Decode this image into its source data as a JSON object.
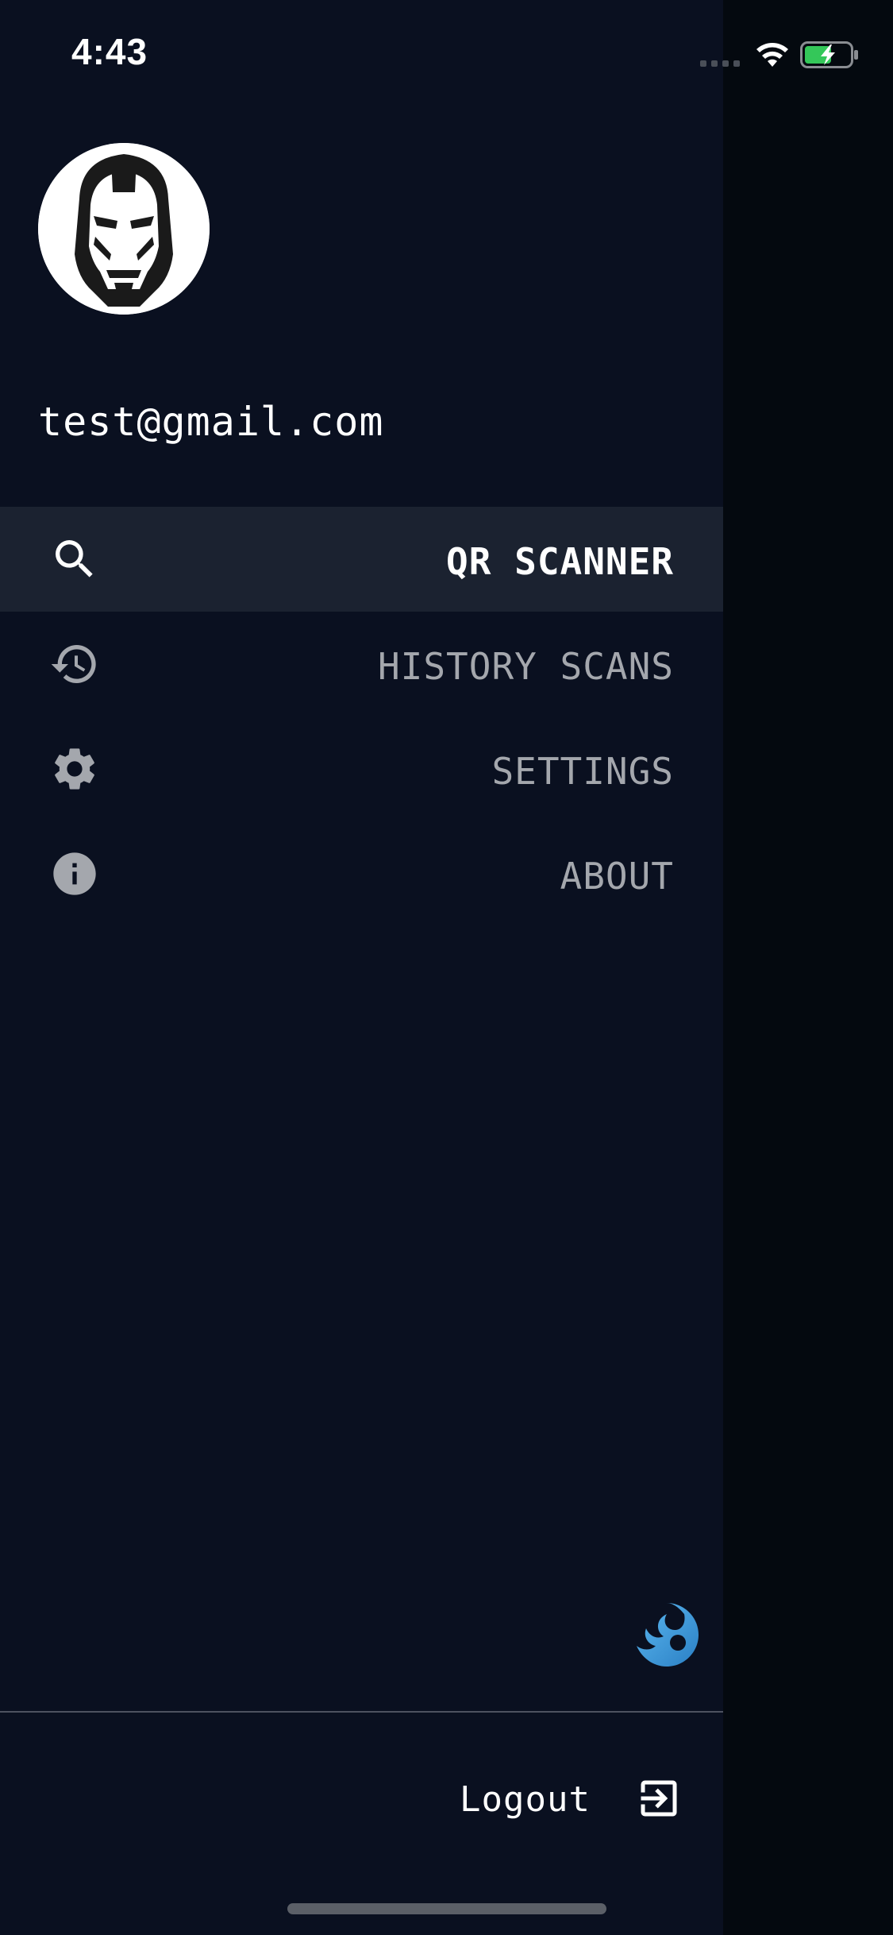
{
  "status_bar": {
    "time": "4:43",
    "icons": [
      "cellular-signal-icon",
      "wifi-icon",
      "battery-charging-icon"
    ]
  },
  "profile": {
    "avatar_icon": "iron-man-helmet-icon",
    "email": "test@gmail.com"
  },
  "menu": {
    "items": [
      {
        "label": "QR SCANNER",
        "icon": "search-icon",
        "active": true
      },
      {
        "label": "HISTORY SCANS",
        "icon": "history-icon",
        "active": false
      },
      {
        "label": "SETTINGS",
        "icon": "gear-icon",
        "active": false
      },
      {
        "label": "ABOUT",
        "icon": "info-icon",
        "active": false
      }
    ]
  },
  "footer": {
    "brand_icon": "brand-logo-icon",
    "logout_label": "Logout",
    "logout_icon": "logout-icon"
  },
  "colors": {
    "drawer_bg": "#0a1020",
    "active_item_bg": "#1b2230",
    "active_text": "#ffffff",
    "inactive_text": "#a4a7ad",
    "brand_blue": "#3d9ad9",
    "battery_green": "#34c759"
  }
}
